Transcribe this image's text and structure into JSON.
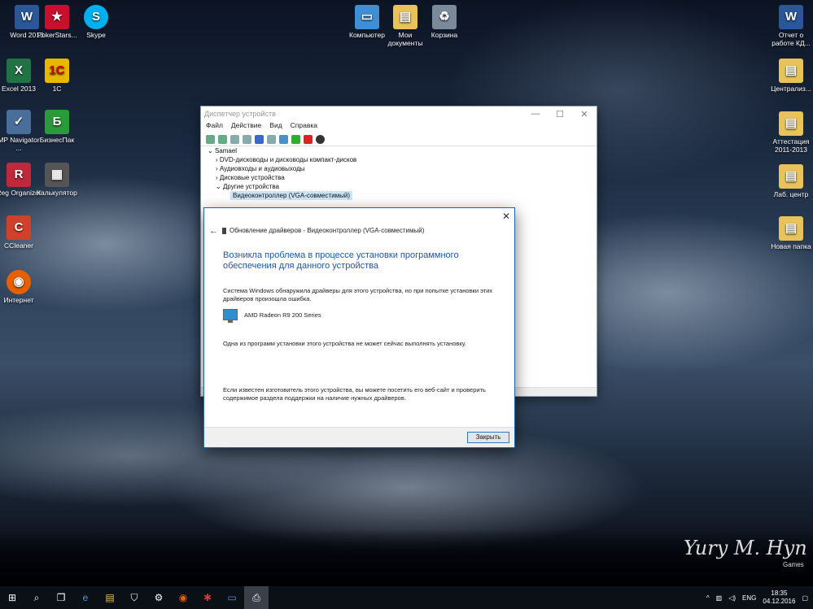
{
  "desktop": {
    "icons_left": [
      {
        "label": "Word 2013",
        "glyph": "W",
        "color": "#2b579a"
      },
      {
        "label": "PokerStars...",
        "glyph": "★",
        "color": "#c8102e"
      },
      {
        "label": "Skype",
        "glyph": "S",
        "color": "#00aff0"
      },
      {
        "label": "Excel 2013",
        "glyph": "X",
        "color": "#217346"
      },
      {
        "label": "1С",
        "glyph": "1С",
        "color": "#e6b800"
      },
      {
        "label": "MP Navigator ...",
        "glyph": "✓",
        "color": "#4a6e9a"
      },
      {
        "label": "БизнесПак",
        "glyph": "Б",
        "color": "#2a9a3a"
      },
      {
        "label": "Reg Organizer",
        "glyph": "R",
        "color": "#c0283c"
      },
      {
        "label": "Калькулятор",
        "glyph": "▦",
        "color": "#555"
      },
      {
        "label": "CCleaner",
        "glyph": "C",
        "color": "#d0402a"
      },
      {
        "label": "Интернет",
        "glyph": "◉",
        "color": "#e66000"
      }
    ],
    "icons_top": [
      {
        "label": "Компьютер",
        "glyph": "▭",
        "color": "#3e8fd6"
      },
      {
        "label": "Мои документы",
        "glyph": "▤",
        "color": "#e8c25a"
      },
      {
        "label": "Корзина",
        "glyph": "♻",
        "color": "#7a8a9a"
      }
    ],
    "icons_right": [
      {
        "label": "Отчет о работе КД...",
        "glyph": "W",
        "color": "#2b579a"
      },
      {
        "label": "Централиз...",
        "glyph": "▤",
        "color": "#e8c25a"
      },
      {
        "label": "Аттестация 2011-2013",
        "glyph": "▤",
        "color": "#e8c25a"
      },
      {
        "label": "Лаб. центр",
        "glyph": "▤",
        "color": "#e8c25a"
      },
      {
        "label": "Новая папка",
        "glyph": "▤",
        "color": "#e8c25a"
      }
    ],
    "signature": "Yury M. Hyn",
    "signature_sub": "Games"
  },
  "device_manager": {
    "title": "Диспетчер устройств",
    "menu": [
      "Файл",
      "Действие",
      "Вид",
      "Справка"
    ],
    "tree": [
      "Samael",
      "DVD-дисководы и дисководы компакт-дисков",
      "Аудиовходы и аудиовыходы",
      "Дисковые устройства",
      "Другие устройства",
      "Видеоконтроллер (VGA-совместимый)"
    ]
  },
  "dialog": {
    "header": "Обновление драйверов - Видеоконтроллер (VGA-совместимый)",
    "main_instruction": "Возникла проблема в процессе установки программного обеспечения для данного устройства",
    "text1": "Система Windows обнаружила драйверы для этого устройства, но при попытке установки этих драйверов произошла ошибка.",
    "device": "AMD Radeon R9 200 Series",
    "text2": "Одна из программ установки этого устройства не может сейчас выполнять установку.",
    "text3": "Если известен изготовитель этого устройства, вы можете посетить его веб-сайт и проверить содержимое раздела поддержки на наличие нужных драйверов.",
    "close_button": "Закрыть"
  },
  "taskbar": {
    "lang": "ENG",
    "time": "18:35",
    "date": "04.12.2016"
  }
}
